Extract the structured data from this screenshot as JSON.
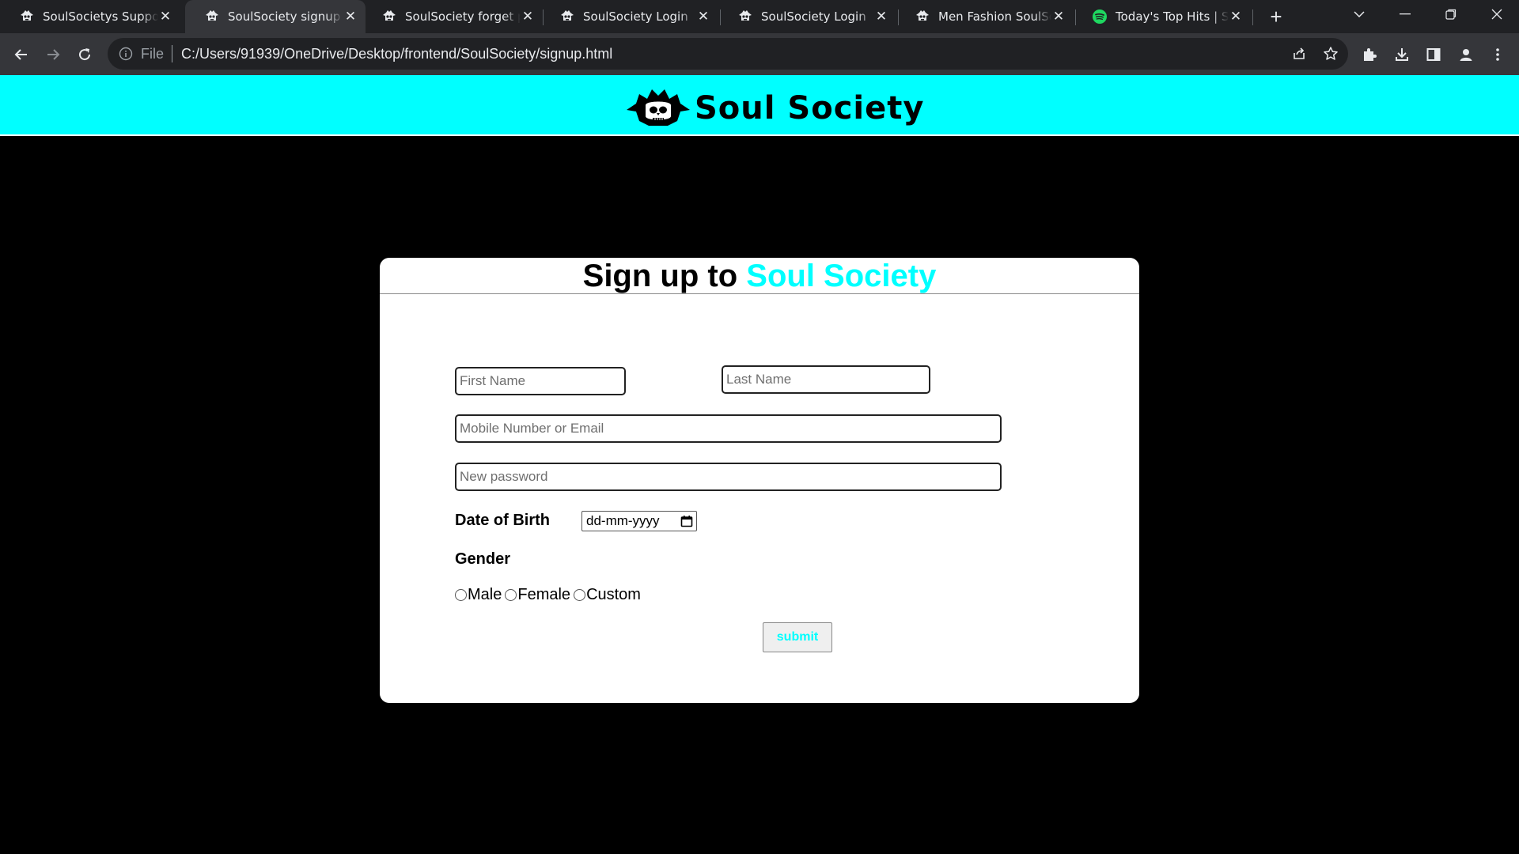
{
  "browser": {
    "tabs": [
      {
        "title": "SoulSocietys Support",
        "icon": "soulsociety-favicon",
        "active": false
      },
      {
        "title": "SoulSociety signup page",
        "icon": "soulsociety-favicon",
        "active": true
      },
      {
        "title": "SoulSociety forget password",
        "icon": "soulsociety-favicon",
        "active": false
      },
      {
        "title": "SoulSociety Login",
        "icon": "soulsociety-favicon",
        "active": false
      },
      {
        "title": "SoulSociety Login",
        "icon": "soulsociety-favicon",
        "active": false
      },
      {
        "title": "Men Fashion SoulSociety",
        "icon": "soulsociety-favicon",
        "active": false
      },
      {
        "title": "Today's Top Hits | Spotify",
        "icon": "spotify-favicon",
        "active": false
      }
    ],
    "address": {
      "scheme_label": "File",
      "url": "C:/Users/91939/OneDrive/Desktop/frontend/SoulSociety/signup.html"
    }
  },
  "site": {
    "brand_name": "Soul Society",
    "brand_color": "#00ffff"
  },
  "signup": {
    "title_prefix": "Sign up to",
    "title_accent": "Soul Society",
    "first_name_placeholder": "First Name",
    "last_name_placeholder": "Last Name",
    "contact_placeholder": "Mobile Number or Email",
    "password_placeholder": "New password",
    "dob_label": "Date of Birth",
    "dob_placeholder": "dd-mm-yyyy",
    "gender_label": "Gender",
    "gender_options": [
      "Male",
      "Female",
      "Custom"
    ],
    "submit_label": "submit"
  }
}
